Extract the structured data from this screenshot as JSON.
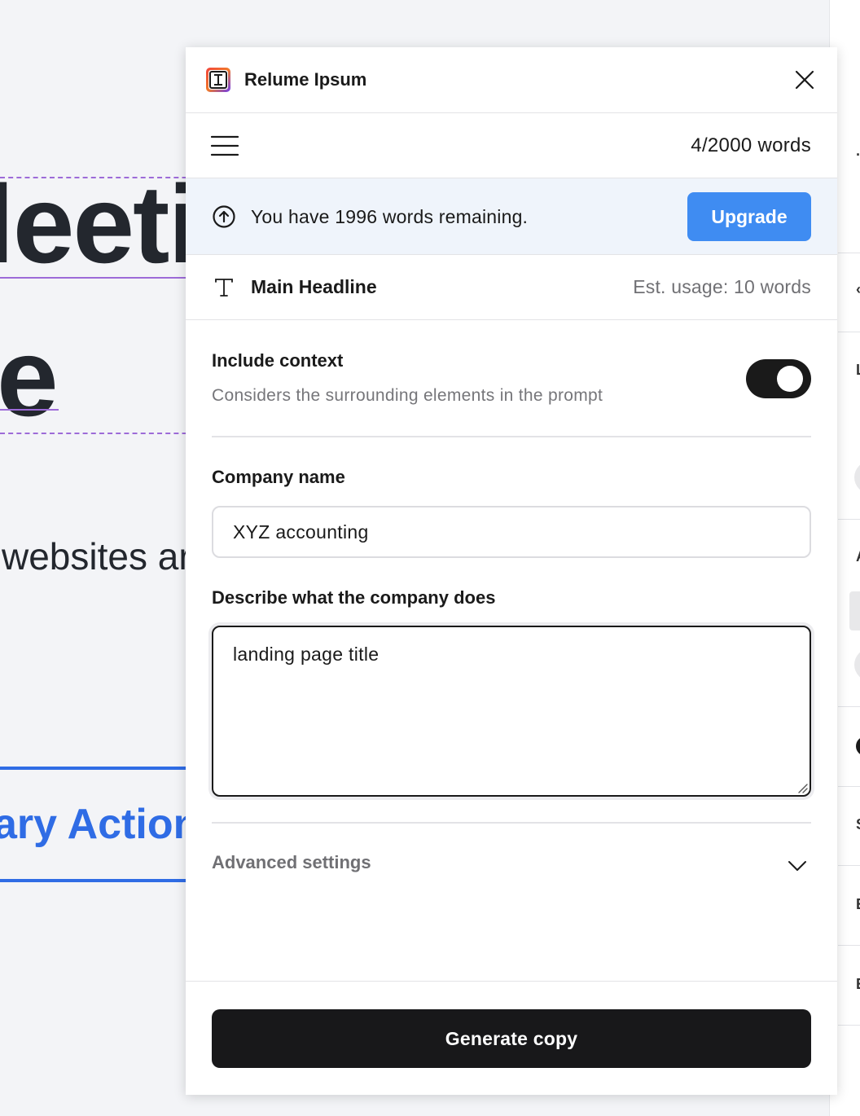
{
  "background": {
    "heading_line1": "leeti",
    "heading_line2": "e",
    "paragraph": "websites ar",
    "button_label": "ary Action"
  },
  "plugin": {
    "title": "Relume Ipsum",
    "logo_icon": "relume-logo-icon",
    "close_icon": "close-icon",
    "menu_icon": "hamburger-menu-icon",
    "word_count": "4/2000 words",
    "banner": {
      "icon": "arrow-up-circle-icon",
      "text": "You have 1996 words remaining.",
      "upgrade_label": "Upgrade",
      "upgrade_color": "#3f8cf2",
      "background_color": "#eff4fb"
    },
    "element": {
      "icon": "text-type-icon",
      "label": "Main Headline",
      "est_usage": "Est. usage: 10 words"
    },
    "context": {
      "title": "Include context",
      "description": "Considers the surrounding elements in the prompt",
      "enabled": true
    },
    "company_name": {
      "label": "Company name",
      "value": "XYZ accounting"
    },
    "describe": {
      "label": "Describe what the company does",
      "value": "landing page title"
    },
    "advanced": {
      "label": "Advanced settings",
      "icon": "chevron-down-icon"
    },
    "generate_label": "Generate copy"
  },
  "colors": {
    "canvas_bg": "#f3f4f7",
    "dark": "#1a1a1a",
    "canvas_heading": "#23272e",
    "canvas_link": "#2f6ce5",
    "selection": "#9d6bd8",
    "muted_text": "#707074"
  }
}
